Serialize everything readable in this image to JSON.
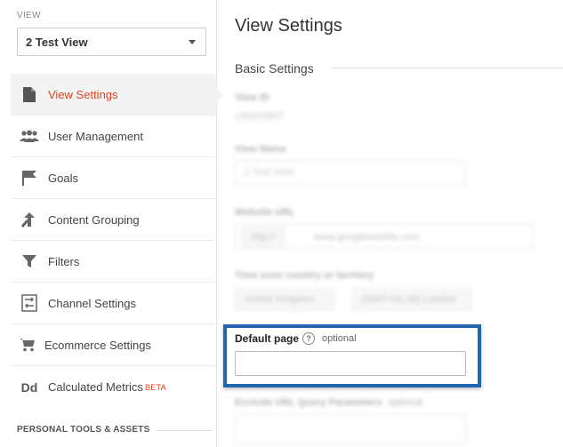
{
  "sidebar": {
    "view_label": "VIEW",
    "view_selected": "2 Test View",
    "items": [
      {
        "label": "View Settings",
        "icon": "document-icon"
      },
      {
        "label": "User Management",
        "icon": "users-icon"
      },
      {
        "label": "Goals",
        "icon": "flag-icon"
      },
      {
        "label": "Content Grouping",
        "icon": "merge-icon"
      },
      {
        "label": "Filters",
        "icon": "filter-icon"
      },
      {
        "label": "Channel Settings",
        "icon": "channel-icon"
      },
      {
        "label": "Ecommerce Settings",
        "icon": "cart-icon"
      },
      {
        "label": "Calculated Metrics",
        "icon": "dd-icon",
        "badge": "BETA",
        "icon_text": "Dd"
      }
    ],
    "personal_heading": "PERSONAL TOOLS & ASSETS"
  },
  "main": {
    "title": "View Settings",
    "section": "Basic Settings",
    "blurred": {
      "view_id_label": "View ID",
      "view_id_value": "130223957",
      "view_name_label": "View Name",
      "view_name_value": "2 Test View",
      "website_url_label": "Website URL",
      "website_url_protocol": "http://",
      "website_url_value": "www.googletestsite.com",
      "timezone_label": "Time zone country or territory",
      "timezone_country": "United Kingdom",
      "timezone_zone": "(GMT+01:00) London",
      "exclude_label": "Exclude URL Query Parameters",
      "exclude_optional": "optional"
    },
    "default_page": {
      "label": "Default page",
      "help": "?",
      "optional": "optional",
      "value": ""
    }
  },
  "colors": {
    "accent": "#e0431b",
    "highlight": "#2166b1"
  }
}
